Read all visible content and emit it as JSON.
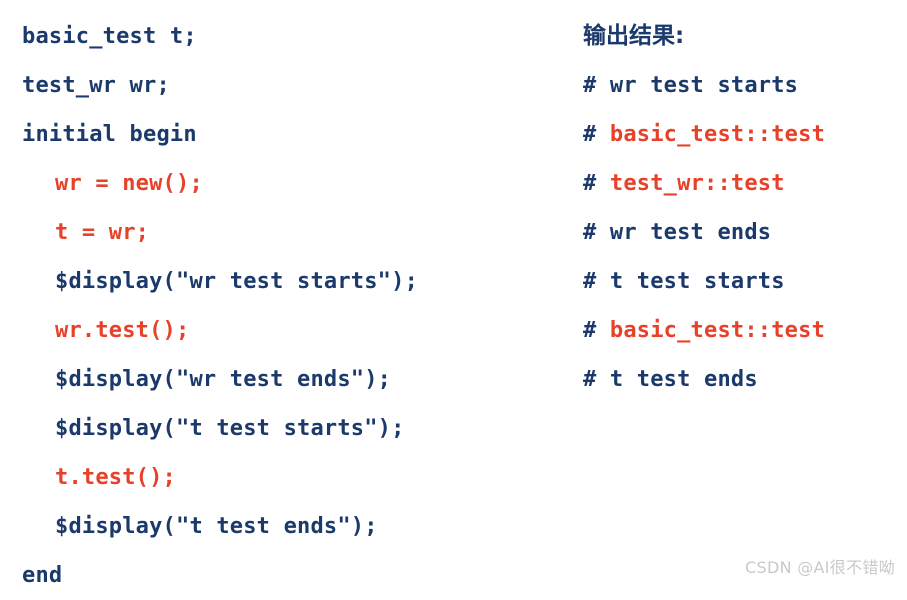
{
  "colors": {
    "background": "#ffffff",
    "keyword_blue": "#1b3a6b",
    "highlight_red": "#e8412a",
    "watermark_gray": "#c9c9c9"
  },
  "code": {
    "lines": [
      {
        "text": "basic_test t;",
        "color": "blue",
        "indent": 0
      },
      {
        "text": "test_wr wr;",
        "color": "blue",
        "indent": 0
      },
      {
        "text": "initial begin",
        "color": "blue",
        "indent": 0
      },
      {
        "text": "wr = new();",
        "color": "red",
        "indent": 1
      },
      {
        "text": "t = wr;",
        "color": "red",
        "indent": 1
      },
      {
        "text": "$display(\"wr test starts\");",
        "color": "blue",
        "indent": 1
      },
      {
        "text": "wr.test();",
        "color": "red",
        "indent": 1
      },
      {
        "text": "$display(\"wr test ends\");",
        "color": "blue",
        "indent": 1
      },
      {
        "text": "$display(\"t test starts\");",
        "color": "blue",
        "indent": 1
      },
      {
        "text": "t.test();",
        "color": "red",
        "indent": 1
      },
      {
        "text": "$display(\"t test ends\");",
        "color": "blue",
        "indent": 1
      },
      {
        "text": "end",
        "color": "blue",
        "indent": 0
      }
    ]
  },
  "output": {
    "header": "输出结果:",
    "lines": [
      {
        "hash": "# ",
        "message": "wr test starts",
        "color": "blue"
      },
      {
        "hash": "# ",
        "message": "basic_test::test",
        "color": "red"
      },
      {
        "hash": "# ",
        "message": "test_wr::test",
        "color": "red"
      },
      {
        "hash": "# ",
        "message": "wr test ends",
        "color": "blue"
      },
      {
        "hash": "# ",
        "message": "t test starts",
        "color": "blue"
      },
      {
        "hash": "# ",
        "message": "basic_test::test",
        "color": "red"
      },
      {
        "hash": "# ",
        "message": "t test ends",
        "color": "blue"
      }
    ]
  },
  "watermark": {
    "text": "CSDN @AI很不错呦"
  }
}
